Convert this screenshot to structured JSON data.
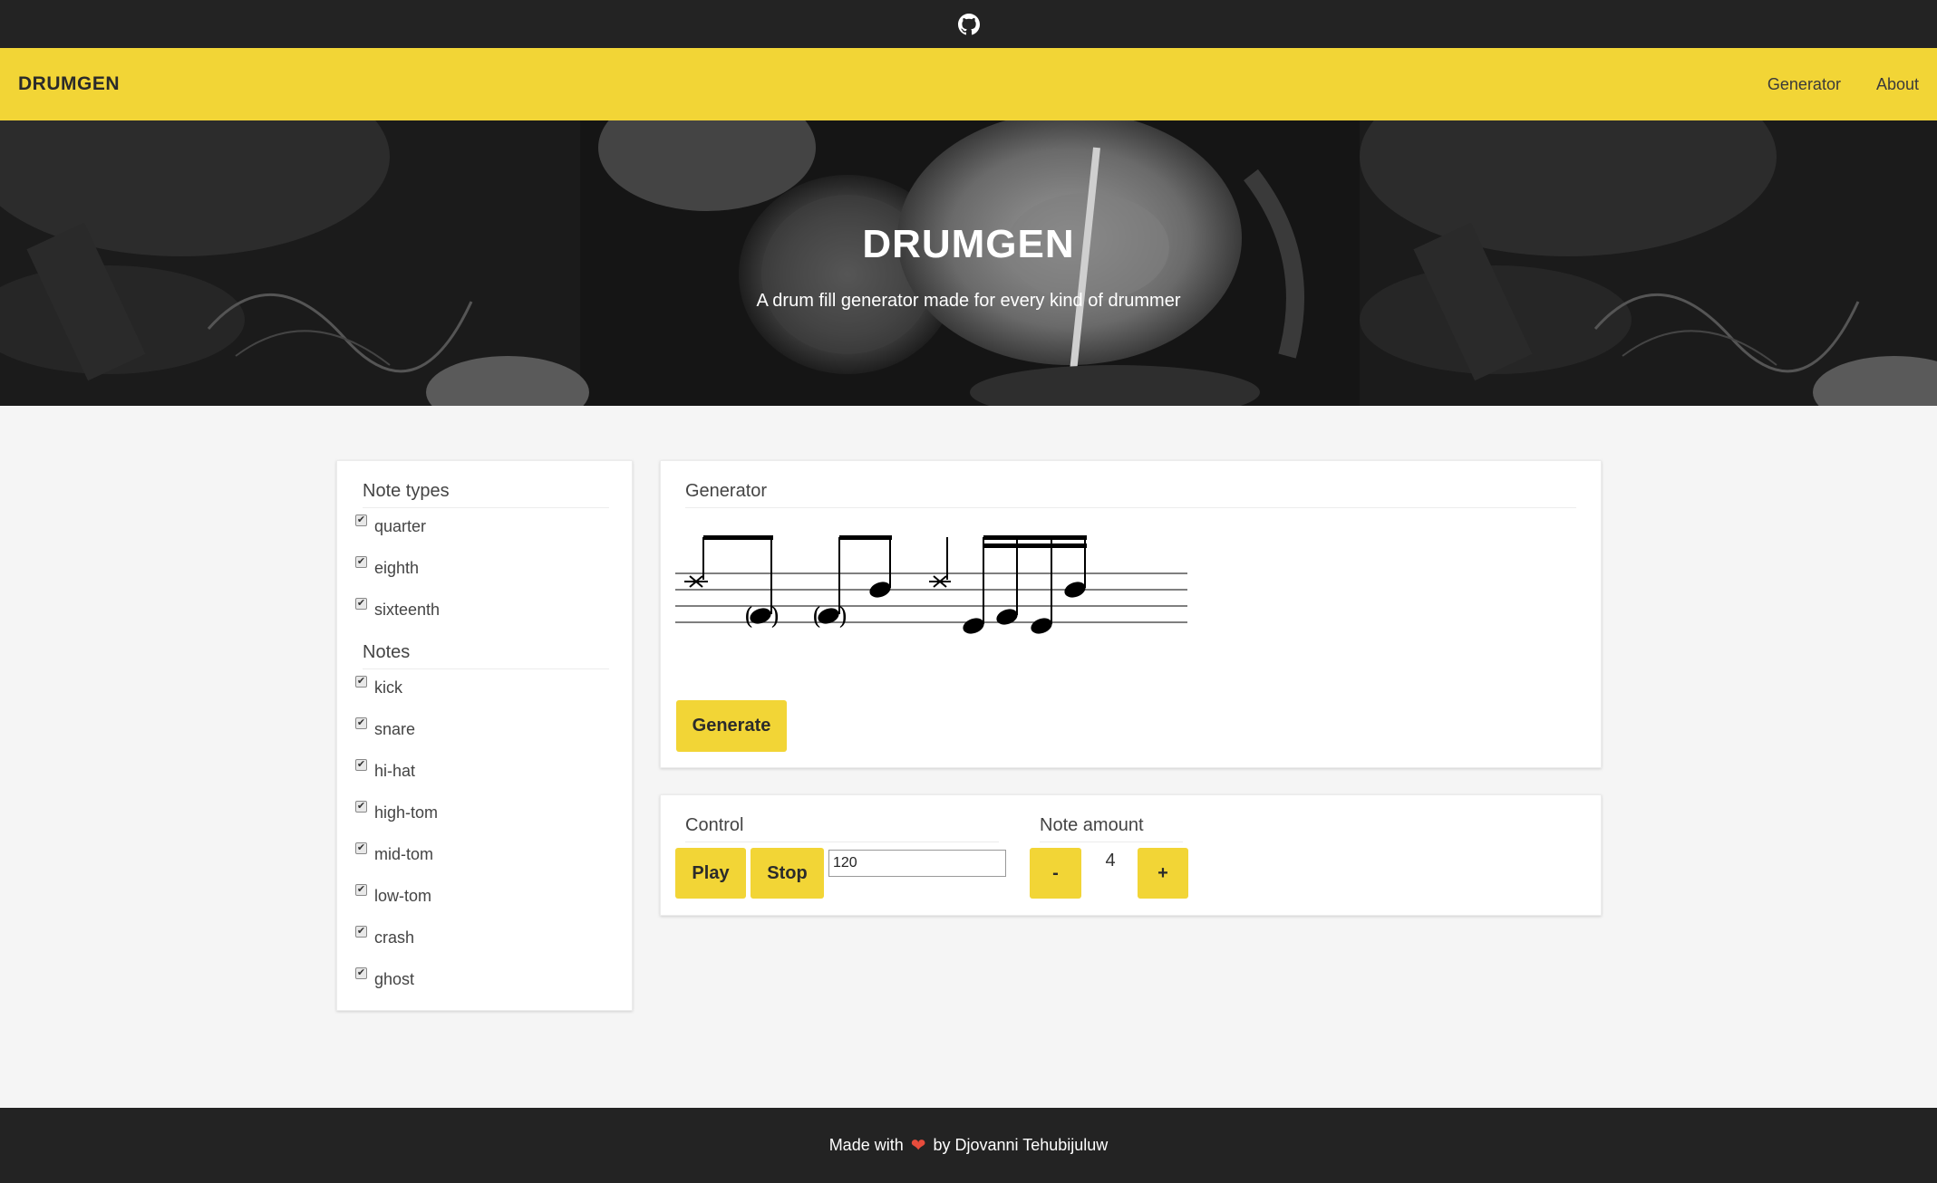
{
  "brand": "DRUMGEN",
  "nav": {
    "generator": "Generator",
    "about": "About"
  },
  "hero": {
    "title": "DRUMGEN",
    "subtitle": "A drum fill generator made for every kind of drummer"
  },
  "note_types": {
    "title": "Note types",
    "items": [
      {
        "label": "quarter",
        "checked": true
      },
      {
        "label": "eighth",
        "checked": true
      },
      {
        "label": "sixteenth",
        "checked": true
      }
    ]
  },
  "notes": {
    "title": "Notes",
    "items": [
      {
        "label": "kick",
        "checked": true
      },
      {
        "label": "snare",
        "checked": true
      },
      {
        "label": "hi-hat",
        "checked": true
      },
      {
        "label": "high-tom",
        "checked": true
      },
      {
        "label": "mid-tom",
        "checked": true
      },
      {
        "label": "low-tom",
        "checked": true
      },
      {
        "label": "crash",
        "checked": true
      },
      {
        "label": "ghost",
        "checked": true
      }
    ]
  },
  "generator": {
    "title": "Generator",
    "generate_label": "Generate"
  },
  "control": {
    "title": "Control",
    "play_label": "Play",
    "stop_label": "Stop",
    "tempo_value": "120"
  },
  "note_amount": {
    "title": "Note amount",
    "minus_label": "-",
    "plus_label": "+",
    "value": "4"
  },
  "footer": {
    "made_with": "Made with",
    "by": "by Djovanni Tehubijuluw"
  },
  "icons": {
    "top": "github-icon",
    "footer": "heart-icon"
  },
  "colors": {
    "accent": "#f2d536",
    "dark": "#232323",
    "heart": "#e74c3c"
  }
}
